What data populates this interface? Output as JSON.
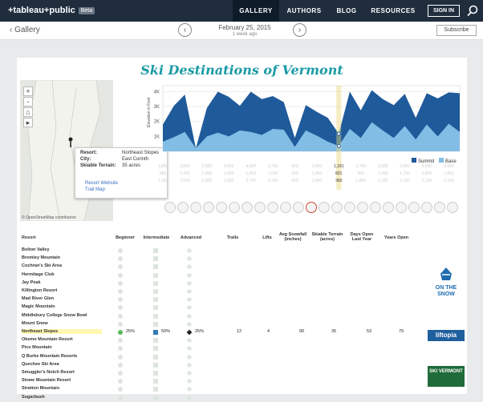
{
  "topnav": {
    "logo": "+tableau+public",
    "badge": "Beta",
    "gallery": "GALLERY",
    "authors": "AUTHORS",
    "blog": "BLOG",
    "resources": "RESOURCES",
    "signin": "SIGN IN"
  },
  "subbar": {
    "back": "Gallery",
    "date": "February 25, 2015",
    "ago": "1 week ago",
    "subscribe": "Subscribe"
  },
  "viz": {
    "title": "Ski Destinations of Vermont"
  },
  "map": {
    "attribution": "© OpenStreetMap contributors",
    "zoom_in": "+",
    "zoom_out": "-"
  },
  "tooltip": {
    "resort_k": "Resort:",
    "resort_v": "Northeast Slopes",
    "city_k": "City:",
    "city_v": "East Corinth",
    "terrain_k": "Skiable Terrain:",
    "terrain_v": "35 acres",
    "website": "Resort Website",
    "trailmap": "Trail Map"
  },
  "chart_data": {
    "type": "area",
    "ylabel": "Elevation in Feet",
    "yticks": [
      "4K",
      "3K",
      "2K",
      "1K"
    ],
    "ylim": [
      0,
      4400
    ],
    "series": [
      {
        "name": "Summit",
        "color": "#1f5a9b",
        "values": [
          1800,
          3050,
          3800,
          200,
          2900,
          4000,
          3650,
          3050,
          4000,
          3500,
          3700,
          3300,
          900,
          3100,
          2650,
          2250,
          1181,
          4000,
          2750,
          4100,
          3500,
          3100,
          3850,
          2250,
          3900,
          3550,
          3950,
          3900
        ]
      },
      {
        "name": "Base",
        "color": "#82bde6",
        "values": [
          650,
          950,
          1300,
          200,
          1000,
          1250,
          1000,
          1400,
          1300,
          1100,
          1500,
          1450,
          300,
          1400,
          1050,
          650,
          360,
          1500,
          900,
          1950,
          1400,
          900,
          1700,
          800,
          1800,
          1000,
          1850,
          1300
        ]
      }
    ],
    "summit_labels": [
      "",
      "",
      "1,181",
      "",
      "",
      "",
      "",
      "",
      "",
      "",
      "",
      ""
    ],
    "legend": [
      "Summit",
      "Base"
    ]
  },
  "table": {
    "headers": {
      "resort": "Resort",
      "beginner": "Beginner",
      "intermediate": "Intermediate",
      "advanced": "Advanced",
      "trails": "Trails",
      "lifts": "Lifts",
      "snowfall": "Avg Snowfall (inches)",
      "terrain": "Skiable Terrain (acres)",
      "days": "Days Open Last Year",
      "years": "Years Open"
    },
    "rows": [
      {
        "name": "Bolton Valley",
        "b": "",
        "i": "",
        "a": "",
        "t": "",
        "l": "",
        "s": "",
        "k": "",
        "d": "",
        "y": ""
      },
      {
        "name": "Bromley Mountain",
        "b": "",
        "i": "",
        "a": "",
        "t": "",
        "l": "",
        "s": "",
        "k": "",
        "d": "",
        "y": ""
      },
      {
        "name": "Cochran's Ski Area",
        "b": "",
        "i": "",
        "a": "",
        "t": "",
        "l": "",
        "s": "",
        "k": "",
        "d": "",
        "y": ""
      },
      {
        "name": "Hermitage Club",
        "b": "",
        "i": "",
        "a": "",
        "t": "",
        "l": "",
        "s": "",
        "k": "",
        "d": "",
        "y": ""
      },
      {
        "name": "Jay Peak",
        "b": "",
        "i": "",
        "a": "",
        "t": "",
        "l": "",
        "s": "",
        "k": "",
        "d": "",
        "y": ""
      },
      {
        "name": "Killington Resort",
        "b": "",
        "i": "",
        "a": "",
        "t": "",
        "l": "",
        "s": "",
        "k": "",
        "d": "",
        "y": ""
      },
      {
        "name": "Mad River Glen",
        "b": "",
        "i": "",
        "a": "",
        "t": "",
        "l": "",
        "s": "",
        "k": "",
        "d": "",
        "y": ""
      },
      {
        "name": "Magic Mountain",
        "b": "",
        "i": "",
        "a": "",
        "t": "",
        "l": "",
        "s": "",
        "k": "",
        "d": "",
        "y": ""
      },
      {
        "name": "Middlebury College Snow Bowl",
        "b": "",
        "i": "",
        "a": "",
        "t": "",
        "l": "",
        "s": "",
        "k": "",
        "d": "",
        "y": ""
      },
      {
        "name": "Mount Snow",
        "b": "",
        "i": "",
        "a": "",
        "t": "",
        "l": "",
        "s": "",
        "k": "",
        "d": "",
        "y": ""
      },
      {
        "name": "Northeast Slopes",
        "b": "25%",
        "i": "50%",
        "a": "25%",
        "t": "12",
        "l": "4",
        "s": "90",
        "k": "35",
        "d": "53",
        "y": "79",
        "hl": true
      },
      {
        "name": "Okemo Mountain Resort",
        "b": "",
        "i": "",
        "a": "",
        "t": "",
        "l": "",
        "s": "",
        "k": "",
        "d": "",
        "y": ""
      },
      {
        "name": "Pico Mountain",
        "b": "",
        "i": "",
        "a": "",
        "t": "",
        "l": "",
        "s": "",
        "k": "",
        "d": "",
        "y": ""
      },
      {
        "name": "Q Burke Mountain Resorts",
        "b": "",
        "i": "",
        "a": "",
        "t": "",
        "l": "",
        "s": "",
        "k": "",
        "d": "",
        "y": ""
      },
      {
        "name": "Quechee Ski Area",
        "b": "",
        "i": "",
        "a": "",
        "t": "",
        "l": "",
        "s": "",
        "k": "",
        "d": "",
        "y": ""
      },
      {
        "name": "Smuggler's Notch Resort",
        "b": "",
        "i": "",
        "a": "",
        "t": "",
        "l": "",
        "s": "",
        "k": "",
        "d": "",
        "y": ""
      },
      {
        "name": "Stowe Mountain Resort",
        "b": "",
        "i": "",
        "a": "",
        "t": "",
        "l": "",
        "s": "",
        "k": "",
        "d": "",
        "y": ""
      },
      {
        "name": "Stratton Mountain",
        "b": "",
        "i": "",
        "a": "",
        "t": "",
        "l": "",
        "s": "",
        "k": "",
        "d": "",
        "y": ""
      },
      {
        "name": "Sugarbush",
        "b": "",
        "i": "",
        "a": "",
        "t": "",
        "l": "",
        "s": "",
        "k": "",
        "d": "",
        "y": ""
      }
    ]
  },
  "sponsors": {
    "onthesnow": "ON THE SNOW",
    "liftopia": "liftopia",
    "skivermont": "SKI VERMONT"
  },
  "colors": {
    "accent": "#1b9aa6",
    "nav": "#1f2d3d",
    "summit": "#1f5a9b",
    "base": "#82bde6"
  }
}
